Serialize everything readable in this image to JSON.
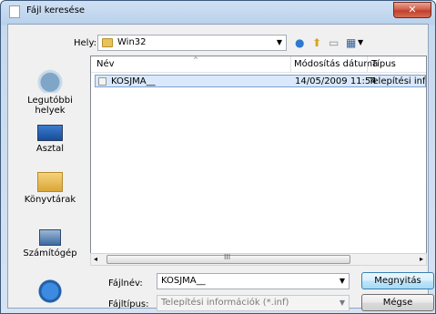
{
  "window": {
    "title": "Fájl keresése",
    "close_glyph": "✕"
  },
  "location": {
    "label": "Hely:",
    "value": "Win32"
  },
  "toolbar_icons": [
    "back-icon",
    "up-folder-icon",
    "new-folder-icon",
    "views-menu-icon"
  ],
  "places": [
    {
      "label": "Legutóbbi helyek",
      "icon": "recent-places-icon"
    },
    {
      "label": "Asztal",
      "icon": "desktop-icon"
    },
    {
      "label": "Könyvtárak",
      "icon": "libraries-icon"
    },
    {
      "label": "Számítógép",
      "icon": "computer-icon"
    },
    {
      "label": "",
      "icon": "network-icon"
    }
  ],
  "columns": {
    "name": "Név",
    "date": "Módosítás dátuma",
    "type": "Típus"
  },
  "files": [
    {
      "name": "KOSJMA__",
      "date": "14/05/2009 11:54",
      "type": "Telepítési info"
    }
  ],
  "scrollbar": {
    "left": "◂",
    "right": "▸",
    "grip": "III"
  },
  "filename": {
    "label": "Fájlnév:",
    "value": "KOSJMA__"
  },
  "filetype": {
    "label": "Fájltípus:",
    "value": "Telepítési információk (*.inf)"
  },
  "buttons": {
    "open": "Megnyitás",
    "cancel": "Mégse"
  }
}
